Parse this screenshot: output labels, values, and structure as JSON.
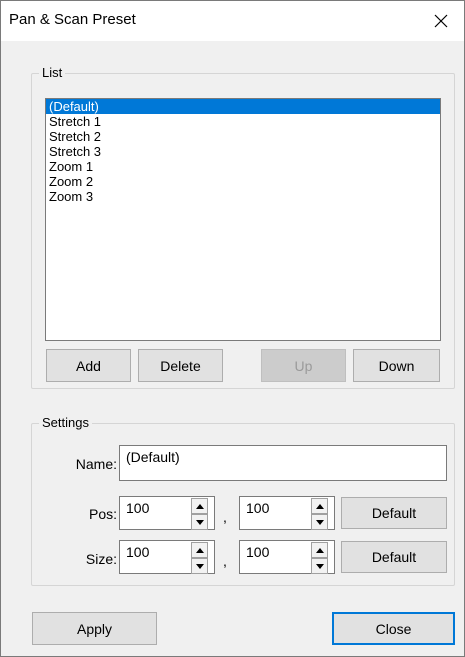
{
  "window": {
    "title": "Pan & Scan Preset"
  },
  "list_group": {
    "label": "List",
    "items": [
      "(Default)",
      "Stretch 1",
      "Stretch 2",
      "Stretch 3",
      "Zoom 1",
      "Zoom 2",
      "Zoom 3"
    ],
    "selected_index": 0,
    "buttons": {
      "add": "Add",
      "delete": "Delete",
      "up": "Up",
      "down": "Down"
    }
  },
  "settings_group": {
    "label": "Settings",
    "name_label": "Name:",
    "name_value": "(Default)",
    "pos_label": "Pos:",
    "pos_x": "100",
    "pos_y": "100",
    "size_label": "Size:",
    "size_x": "100",
    "size_y": "100",
    "separator": ",",
    "default_label": "Default"
  },
  "footer": {
    "apply": "Apply",
    "close": "Close"
  },
  "icons": {
    "close": "close-icon",
    "spin_up": "spin-up-icon",
    "spin_down": "spin-down-icon"
  },
  "colors": {
    "selection": "#0078d7",
    "default_button_border": "#0078d7"
  }
}
